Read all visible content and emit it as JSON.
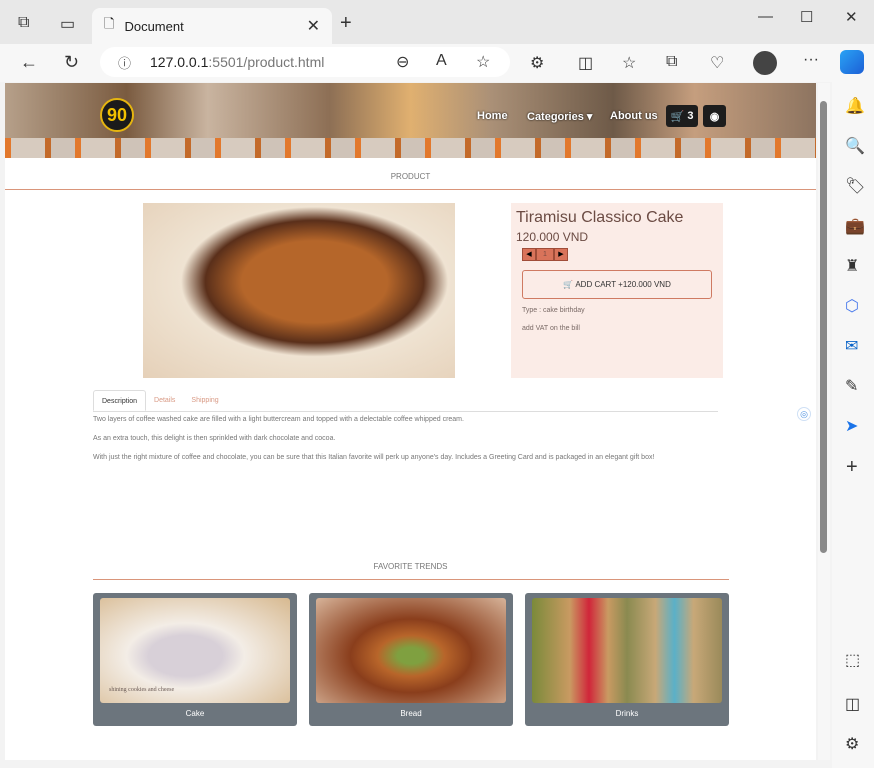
{
  "browser": {
    "tab_title": "Document",
    "url_host": "127.0.0.1",
    "url_rest": ":5501/product.html"
  },
  "nav": {
    "logo": "90",
    "home": "Home",
    "categories": "Categories",
    "about": "About us",
    "cart_count": "3"
  },
  "section_product": "PRODUCT",
  "product": {
    "name": "Tiramisu Classico Cake",
    "price": "120.000 VND",
    "quantity": "1",
    "add_cart": "ADD CART +120.000 VND",
    "type": "Type : cake birthday",
    "vat": "add VAT on the bill"
  },
  "tabs": [
    "Description",
    "Details",
    "Shipping"
  ],
  "description": [
    "Two layers of coffee washed cake are filled with a light buttercream and topped with a delectable coffee whipped cream.",
    "As an extra touch, this delight is then sprinkled with dark chocolate and cocoa.",
    "With just the right mixture of coffee and chocolate, you can be sure that this Italian favorite will perk up anyone's day. Includes a Greeting Card and is packaged in an elegant gift box!"
  ],
  "section_trends": "FAVORITE TRENDS",
  "trends": [
    {
      "label": "Cake",
      "caption": "shining cookies and cheese"
    },
    {
      "label": "Bread"
    },
    {
      "label": "Drinks"
    }
  ],
  "colors": {
    "accent": "#d9957a",
    "card_bg": "#6c757d",
    "info_bg": "#fbece7"
  }
}
